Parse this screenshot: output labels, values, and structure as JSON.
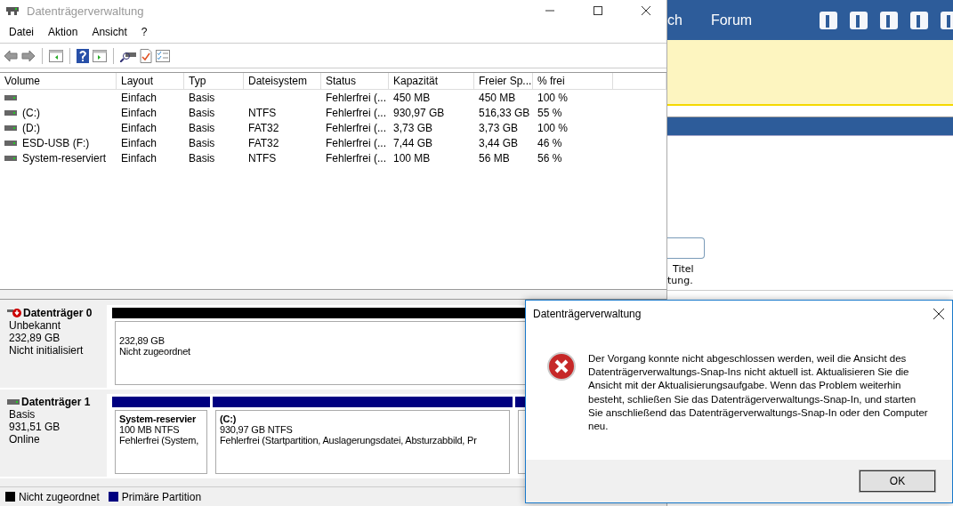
{
  "window": {
    "title": "Datenträgerverwaltung"
  },
  "menu": [
    "Datei",
    "Aktion",
    "Ansicht",
    "?"
  ],
  "table": {
    "columns": [
      "Volume",
      "Layout",
      "Typ",
      "Dateisystem",
      "Status",
      "Kapazität",
      "Freier Sp...",
      "% frei"
    ],
    "rows": [
      {
        "cells": [
          "",
          "Einfach",
          "Basis",
          "",
          "Fehlerfrei (...",
          "450 MB",
          "450 MB",
          "100 %"
        ]
      },
      {
        "cells": [
          "(C:)",
          "Einfach",
          "Basis",
          "NTFS",
          "Fehlerfrei (...",
          "930,97 GB",
          "516,33 GB",
          "55 %"
        ]
      },
      {
        "cells": [
          "(D:)",
          "Einfach",
          "Basis",
          "FAT32",
          "Fehlerfrei (...",
          "3,73 GB",
          "3,73 GB",
          "100 %"
        ]
      },
      {
        "cells": [
          "ESD-USB (F:)",
          "Einfach",
          "Basis",
          "FAT32",
          "Fehlerfrei (...",
          "7,44 GB",
          "3,44 GB",
          "46 %"
        ]
      },
      {
        "cells": [
          "System-reserviert",
          "Einfach",
          "Basis",
          "NTFS",
          "Fehlerfrei (...",
          "100 MB",
          "56 MB",
          "56 %"
        ]
      }
    ]
  },
  "disks": [
    {
      "name": "Datenträger 0",
      "kind": "error",
      "lines": [
        "Unbekannt",
        "232,89 GB",
        "Nicht initialisiert"
      ],
      "partitions": [
        {
          "color": "#000000",
          "lines": [
            "232,89 GB",
            "Nicht zugeordnet"
          ]
        }
      ]
    },
    {
      "name": "Datenträger 1",
      "kind": "online",
      "lines": [
        "Basis",
        "931,51 GB",
        "Online"
      ],
      "partitions": [
        {
          "color": "#000080",
          "title": "System-reservier",
          "lines": [
            "100 MB NTFS",
            "Fehlerfrei (System,"
          ]
        },
        {
          "color": "#000080",
          "title": "(C:)",
          "lines": [
            "930,97 GB NTFS",
            "Fehlerfrei (Startpartition, Auslagerungsdatei, Absturzabbild, Pr"
          ]
        },
        {
          "color": "#000080"
        }
      ]
    }
  ],
  "legend": [
    {
      "label": "Nicht zugeordnet",
      "color": "#000000"
    },
    {
      "label": "Primäre Partition",
      "color": "#000080"
    }
  ],
  "web": {
    "nav": [
      "ch",
      "Forum"
    ],
    "texts": [
      "Titel",
      "tung."
    ]
  },
  "dialog": {
    "title": "Datenträgerverwaltung",
    "message": "Der Vorgang konnte nicht abgeschlossen werden, weil die Ansicht des Datenträgerverwaltungs-Snap-Ins nicht aktuell ist. Aktualisieren Sie die Ansicht mit der Aktualisierungsaufgabe. Wenn das Problem weiterhin besteht, schließen Sie das Datenträgerverwaltungs-Snap-In, und starten Sie anschließend das Datenträgerverwaltungs-Snap-In oder den Computer neu.",
    "button": "OK"
  }
}
